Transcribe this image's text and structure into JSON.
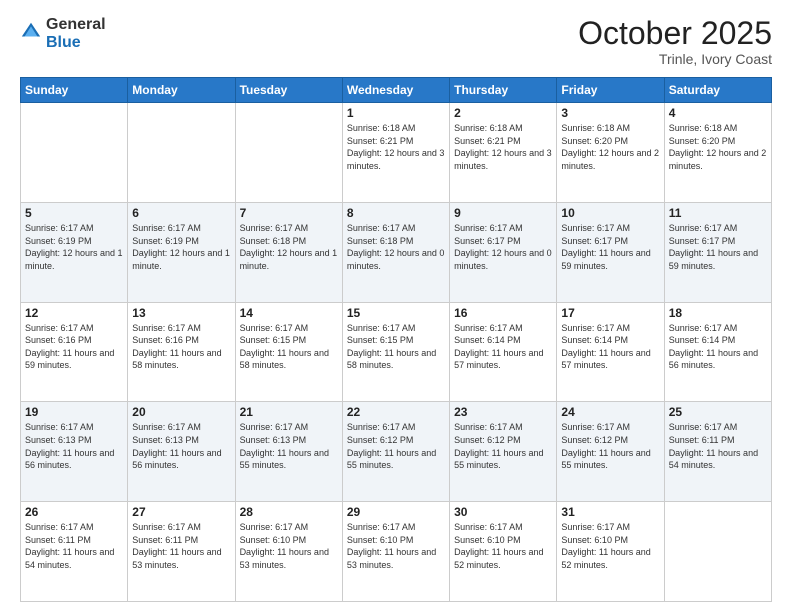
{
  "logo": {
    "general": "General",
    "blue": "Blue"
  },
  "header": {
    "month": "October 2025",
    "location": "Trinle, Ivory Coast"
  },
  "weekdays": [
    "Sunday",
    "Monday",
    "Tuesday",
    "Wednesday",
    "Thursday",
    "Friday",
    "Saturday"
  ],
  "weeks": [
    [
      {
        "day": "",
        "info": ""
      },
      {
        "day": "",
        "info": ""
      },
      {
        "day": "",
        "info": ""
      },
      {
        "day": "1",
        "info": "Sunrise: 6:18 AM\nSunset: 6:21 PM\nDaylight: 12 hours and 3 minutes."
      },
      {
        "day": "2",
        "info": "Sunrise: 6:18 AM\nSunset: 6:21 PM\nDaylight: 12 hours and 3 minutes."
      },
      {
        "day": "3",
        "info": "Sunrise: 6:18 AM\nSunset: 6:20 PM\nDaylight: 12 hours and 2 minutes."
      },
      {
        "day": "4",
        "info": "Sunrise: 6:18 AM\nSunset: 6:20 PM\nDaylight: 12 hours and 2 minutes."
      }
    ],
    [
      {
        "day": "5",
        "info": "Sunrise: 6:17 AM\nSunset: 6:19 PM\nDaylight: 12 hours and 1 minute."
      },
      {
        "day": "6",
        "info": "Sunrise: 6:17 AM\nSunset: 6:19 PM\nDaylight: 12 hours and 1 minute."
      },
      {
        "day": "7",
        "info": "Sunrise: 6:17 AM\nSunset: 6:18 PM\nDaylight: 12 hours and 1 minute."
      },
      {
        "day": "8",
        "info": "Sunrise: 6:17 AM\nSunset: 6:18 PM\nDaylight: 12 hours and 0 minutes."
      },
      {
        "day": "9",
        "info": "Sunrise: 6:17 AM\nSunset: 6:17 PM\nDaylight: 12 hours and 0 minutes."
      },
      {
        "day": "10",
        "info": "Sunrise: 6:17 AM\nSunset: 6:17 PM\nDaylight: 11 hours and 59 minutes."
      },
      {
        "day": "11",
        "info": "Sunrise: 6:17 AM\nSunset: 6:17 PM\nDaylight: 11 hours and 59 minutes."
      }
    ],
    [
      {
        "day": "12",
        "info": "Sunrise: 6:17 AM\nSunset: 6:16 PM\nDaylight: 11 hours and 59 minutes."
      },
      {
        "day": "13",
        "info": "Sunrise: 6:17 AM\nSunset: 6:16 PM\nDaylight: 11 hours and 58 minutes."
      },
      {
        "day": "14",
        "info": "Sunrise: 6:17 AM\nSunset: 6:15 PM\nDaylight: 11 hours and 58 minutes."
      },
      {
        "day": "15",
        "info": "Sunrise: 6:17 AM\nSunset: 6:15 PM\nDaylight: 11 hours and 58 minutes."
      },
      {
        "day": "16",
        "info": "Sunrise: 6:17 AM\nSunset: 6:14 PM\nDaylight: 11 hours and 57 minutes."
      },
      {
        "day": "17",
        "info": "Sunrise: 6:17 AM\nSunset: 6:14 PM\nDaylight: 11 hours and 57 minutes."
      },
      {
        "day": "18",
        "info": "Sunrise: 6:17 AM\nSunset: 6:14 PM\nDaylight: 11 hours and 56 minutes."
      }
    ],
    [
      {
        "day": "19",
        "info": "Sunrise: 6:17 AM\nSunset: 6:13 PM\nDaylight: 11 hours and 56 minutes."
      },
      {
        "day": "20",
        "info": "Sunrise: 6:17 AM\nSunset: 6:13 PM\nDaylight: 11 hours and 56 minutes."
      },
      {
        "day": "21",
        "info": "Sunrise: 6:17 AM\nSunset: 6:13 PM\nDaylight: 11 hours and 55 minutes."
      },
      {
        "day": "22",
        "info": "Sunrise: 6:17 AM\nSunset: 6:12 PM\nDaylight: 11 hours and 55 minutes."
      },
      {
        "day": "23",
        "info": "Sunrise: 6:17 AM\nSunset: 6:12 PM\nDaylight: 11 hours and 55 minutes."
      },
      {
        "day": "24",
        "info": "Sunrise: 6:17 AM\nSunset: 6:12 PM\nDaylight: 11 hours and 55 minutes."
      },
      {
        "day": "25",
        "info": "Sunrise: 6:17 AM\nSunset: 6:11 PM\nDaylight: 11 hours and 54 minutes."
      }
    ],
    [
      {
        "day": "26",
        "info": "Sunrise: 6:17 AM\nSunset: 6:11 PM\nDaylight: 11 hours and 54 minutes."
      },
      {
        "day": "27",
        "info": "Sunrise: 6:17 AM\nSunset: 6:11 PM\nDaylight: 11 hours and 53 minutes."
      },
      {
        "day": "28",
        "info": "Sunrise: 6:17 AM\nSunset: 6:10 PM\nDaylight: 11 hours and 53 minutes."
      },
      {
        "day": "29",
        "info": "Sunrise: 6:17 AM\nSunset: 6:10 PM\nDaylight: 11 hours and 53 minutes."
      },
      {
        "day": "30",
        "info": "Sunrise: 6:17 AM\nSunset: 6:10 PM\nDaylight: 11 hours and 52 minutes."
      },
      {
        "day": "31",
        "info": "Sunrise: 6:17 AM\nSunset: 6:10 PM\nDaylight: 11 hours and 52 minutes."
      },
      {
        "day": "",
        "info": ""
      }
    ]
  ]
}
